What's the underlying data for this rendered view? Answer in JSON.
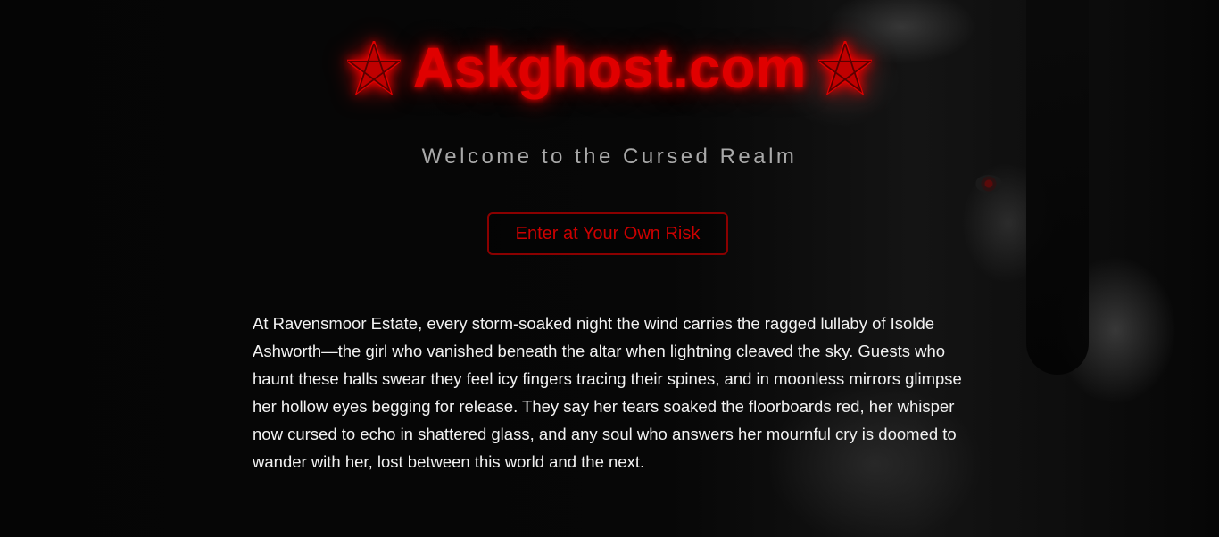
{
  "header": {
    "title": "Askghost.com",
    "left_icon": "pentagram-icon",
    "right_icon": "pentagram-icon"
  },
  "hero": {
    "subtitle": "Welcome to the Cursed Realm",
    "enter_button_label": "Enter at Your Own Risk"
  },
  "story": {
    "text": "At Ravensmoor Estate, every storm-soaked night the wind carries the ragged lullaby of Isolde Ashworth—the girl who vanished beneath the altar when lightning cleaved the sky. Guests who haunt these halls swear they feel icy fingers tracing their spines, and in moonless mirrors glimpse her hollow eyes begging for release. They say her tears soaked the floorboards red, her whisper now cursed to echo in shattered glass, and any soul who answers her mournful cry is doomed to wander with her, lost between this world and the next."
  },
  "colors": {
    "accent_red": "#e00000",
    "button_border": "#8a0000",
    "subtitle_gray": "#a9a9a9",
    "background": "#050505"
  }
}
